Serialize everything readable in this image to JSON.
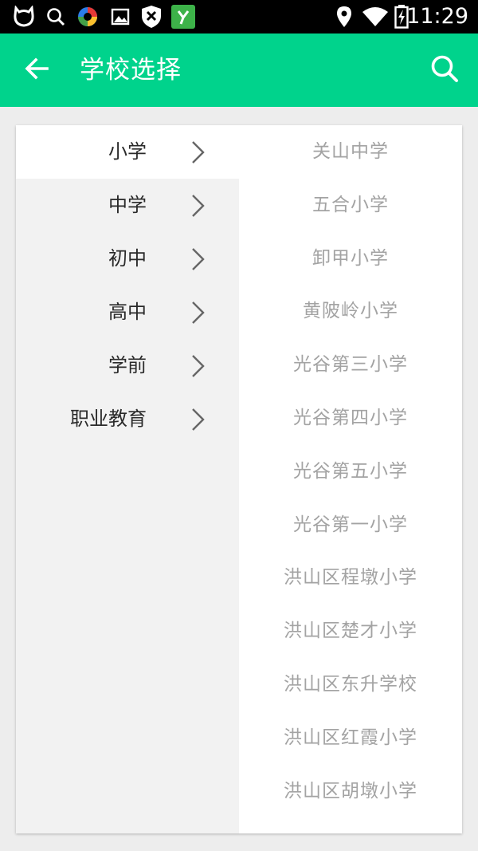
{
  "status_bar": {
    "time": "11:29",
    "icons": [
      "cat-face-icon",
      "search-icon",
      "color-wheel-icon",
      "image-icon",
      "shield-x-icon",
      "app-y-icon",
      "location-pin-icon",
      "wifi-icon",
      "battery-charging-icon"
    ],
    "app_badge_letter": "Y"
  },
  "app_bar": {
    "title": "学校选择",
    "back_icon": "arrow-left-icon",
    "search_icon": "search-icon",
    "background_color": "#00d38c"
  },
  "categories": [
    {
      "label": "小学",
      "active": true
    },
    {
      "label": "中学",
      "active": false
    },
    {
      "label": "初中",
      "active": false
    },
    {
      "label": "高中",
      "active": false
    },
    {
      "label": "学前",
      "active": false
    },
    {
      "label": "职业教育",
      "active": false
    }
  ],
  "schools": [
    "关山中学",
    "五合小学",
    "卸甲小学",
    "黄陂岭小学",
    "光谷第三小学",
    "光谷第四小学",
    "光谷第五小学",
    "光谷第一小学",
    "洪山区程墩小学",
    "洪山区楚才小学",
    "洪山区东升学校",
    "洪山区红霞小学",
    "洪山区胡墩小学"
  ]
}
